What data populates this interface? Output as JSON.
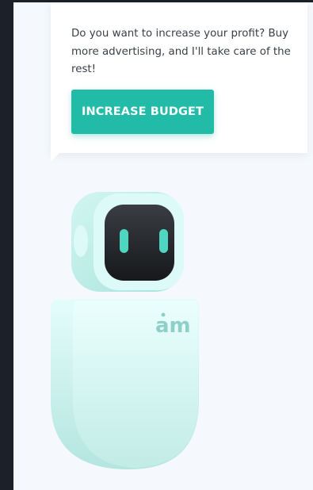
{
  "bubble": {
    "message": "Do you want to increase your profit? Buy more advertising, and I'll take care of the rest!",
    "button_label": "INCREASE BUDGET"
  },
  "robot": {
    "badge_text": "am",
    "icon": "robot-mascot-illustration"
  },
  "colors": {
    "accent": "#21bba8",
    "background": "#f5f9fd",
    "sidebar": "#1b2029",
    "robot_body": "#c8f0ec",
    "robot_eye": "#4fd6c2"
  }
}
